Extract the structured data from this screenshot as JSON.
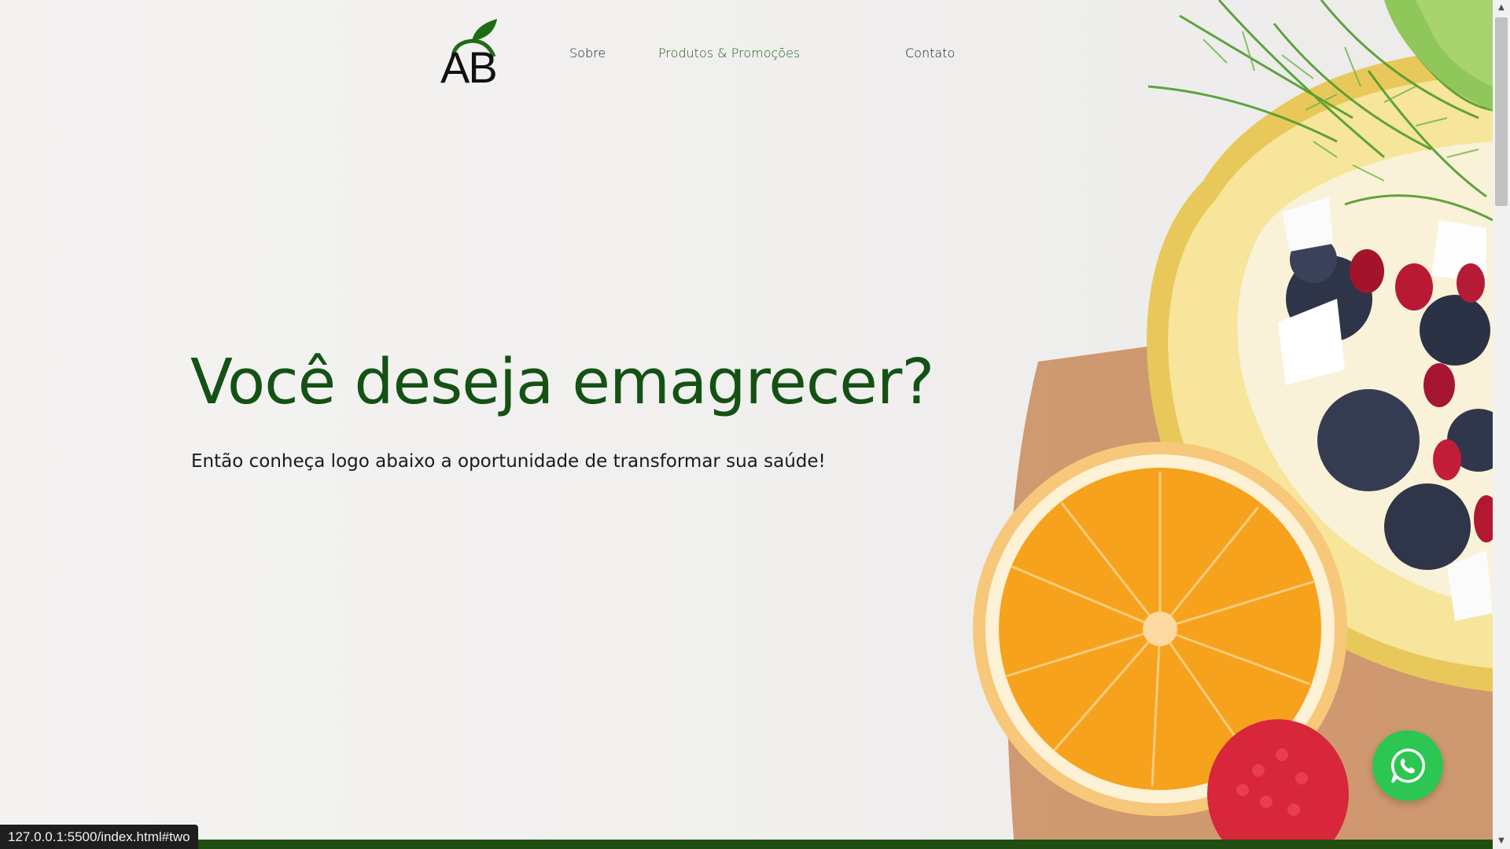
{
  "header": {
    "logo_text": "AB",
    "nav": [
      {
        "label": "Sobre",
        "active": false
      },
      {
        "label": "Produtos & Promoções",
        "active": true
      },
      {
        "label": "Contato",
        "active": false
      }
    ]
  },
  "hero": {
    "title": "Você deseja emagrecer?",
    "subtitle": "Então conheça logo abaixo a oportunidade de transformar sua saúde!"
  },
  "floating_button": {
    "icon": "whatsapp-icon",
    "color": "#2dc653"
  },
  "status_bar": {
    "url": "127.0.0.1:5500/index.html#two"
  },
  "colors": {
    "brand_green": "#145214",
    "active_nav": "#1e5a12",
    "bottom_bar": "#1f4d12",
    "whatsapp": "#2dc653"
  }
}
